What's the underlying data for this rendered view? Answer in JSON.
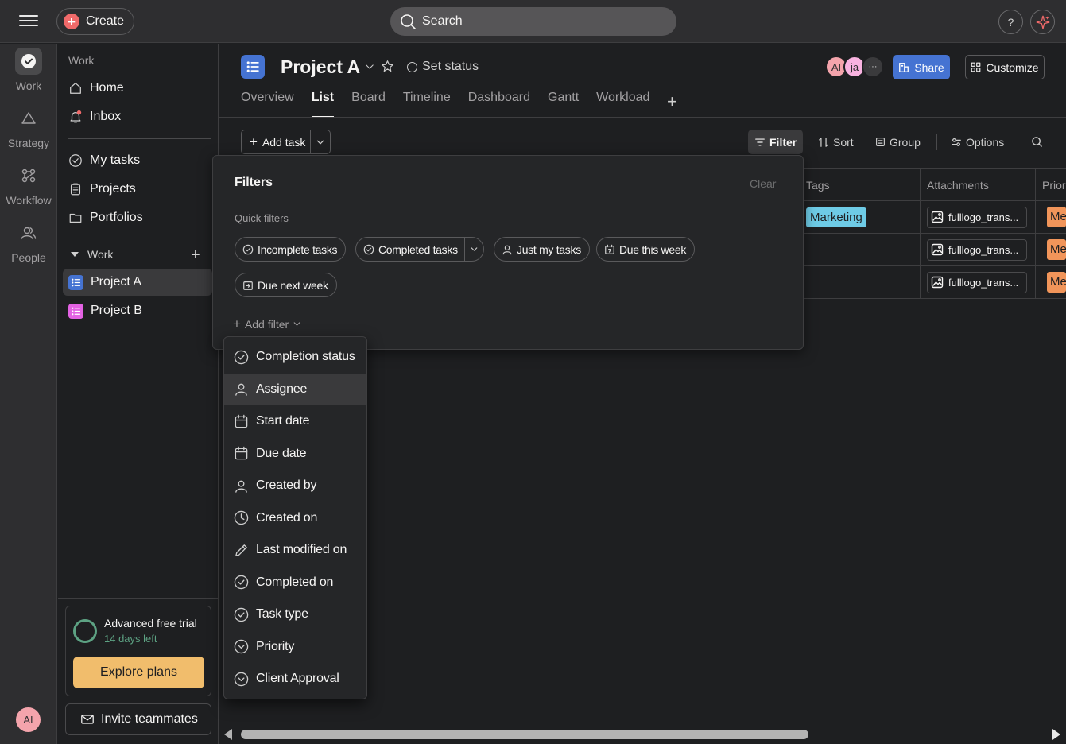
{
  "topbar": {
    "create_label": "Create",
    "search_label": "Search",
    "help_label": "?"
  },
  "rail": {
    "items": [
      {
        "label": "Work",
        "icon": "check-circle-icon"
      },
      {
        "label": "Strategy",
        "icon": "triangle-icon"
      },
      {
        "label": "Workflow",
        "icon": "workflow-icon"
      },
      {
        "label": "People",
        "icon": "people-icon"
      }
    ],
    "avatar_initials": "AI"
  },
  "sidebar": {
    "work_heading": "Work",
    "nav": [
      {
        "label": "Home",
        "icon": "home-icon"
      },
      {
        "label": "Inbox",
        "icon": "bell-icon"
      }
    ],
    "personal": [
      {
        "label": "My tasks",
        "icon": "check-circle-icon"
      },
      {
        "label": "Projects",
        "icon": "clipboard-icon"
      },
      {
        "label": "Portfolios",
        "icon": "folder-icon"
      }
    ],
    "section_label": "Work",
    "projects": [
      {
        "label": "Project A",
        "color": "#4573d2"
      },
      {
        "label": "Project B",
        "color": "#e362e3"
      }
    ],
    "trial": {
      "title": "Advanced free trial",
      "days_left": "14 days left",
      "explore_label": "Explore plans"
    },
    "invite_label": "Invite teammates"
  },
  "project": {
    "title": "Project A",
    "set_status": "Set status",
    "members": [
      {
        "initials": "AI",
        "color": "#f4a4ac"
      },
      {
        "initials": "ja",
        "color": "#f9b3e1"
      }
    ],
    "more_members": "···",
    "share_label": "Share",
    "customize_label": "Customize",
    "tabs": [
      "Overview",
      "List",
      "Board",
      "Timeline",
      "Dashboard",
      "Gantt",
      "Workload"
    ],
    "active_tab": "List",
    "tab_add": "+"
  },
  "toolbar": {
    "add_task": "Add task",
    "filter": "Filter",
    "sort": "Sort",
    "group": "Group",
    "options": "Options"
  },
  "table": {
    "columns": [
      "Tags",
      "Attachments",
      "Prior"
    ],
    "rows": [
      {
        "tag": "Marketing",
        "attachment": "fulllogo_trans...",
        "priority": "Me"
      },
      {
        "tag": "",
        "attachment": "fulllogo_trans...",
        "priority": "Me"
      },
      {
        "tag": "",
        "attachment": "fulllogo_trans...",
        "priority": "Me"
      }
    ]
  },
  "filters": {
    "title": "Filters",
    "clear": "Clear",
    "quick_heading": "Quick filters",
    "chips": [
      {
        "label": "Incomplete tasks",
        "icon": "check-circle-icon"
      },
      {
        "label": "Completed tasks",
        "icon": "check-circle-icon"
      },
      {
        "label": "Just my tasks",
        "icon": "person-icon"
      },
      {
        "label": "Due this week",
        "icon": "calendar-icon"
      },
      {
        "label": "Due next week",
        "icon": "calendar-arrow-icon"
      }
    ],
    "add_filter": "Add filter"
  },
  "filter_menu": {
    "items": [
      {
        "label": "Completion status",
        "icon": "check-circle-icon"
      },
      {
        "label": "Assignee",
        "icon": "person-icon"
      },
      {
        "label": "Start date",
        "icon": "calendar-icon"
      },
      {
        "label": "Due date",
        "icon": "calendar-icon"
      },
      {
        "label": "Created by",
        "icon": "person-icon"
      },
      {
        "label": "Created on",
        "icon": "clock-icon"
      },
      {
        "label": "Last modified on",
        "icon": "pencil-icon"
      },
      {
        "label": "Completed on",
        "icon": "check-circle-icon"
      },
      {
        "label": "Task type",
        "icon": "check-circle-icon"
      },
      {
        "label": "Priority",
        "icon": "chevron-circle-icon"
      },
      {
        "label": "Client Approval",
        "icon": "chevron-circle-icon"
      }
    ],
    "highlighted": "Assignee"
  }
}
